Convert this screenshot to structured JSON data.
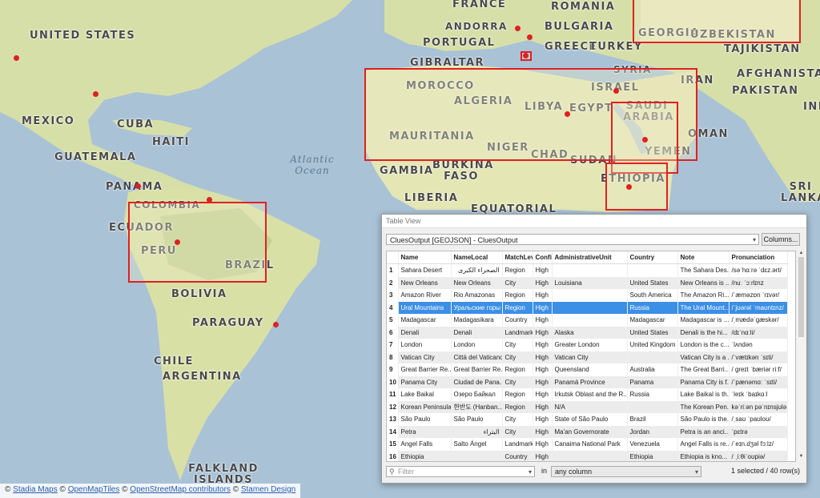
{
  "map": {
    "countries": [
      "UNITED STATES",
      "MEXICO",
      "CUBA",
      "HAITI",
      "GUATEMALA",
      "PANAMA",
      "COLOMBIA",
      "ECUADOR",
      "PERU",
      "BRAZIL",
      "BOLIVIA",
      "PARAGUAY",
      "CHILE",
      "ARGENTINA",
      "FALKLAND ISLANDS",
      "FRANCE",
      "ROMANIA",
      "ANDORRA",
      "BULGARIA",
      "PORTUGAL",
      "GEORGIA",
      "UZBEKISTAN",
      "TAJIKISTAN",
      "GREECE",
      "TURKEY",
      "GIBRALTAR",
      "SYRIA",
      "ISRAEL",
      "IRAN",
      "AFGHANISTAN",
      "PAKISTAN",
      "MOROCCO",
      "ALGERIA",
      "LIBYA",
      "EGYPT",
      "SAUDI ARABIA",
      "OMAN",
      "YEMEN",
      "MAURITANIA",
      "NIGER",
      "CHAD",
      "SUDAN",
      "GAMBIA",
      "BURKINA FASO",
      "ETHIOPIA",
      "LIBERIA",
      "EQUATORIAL",
      "SRI LANKA",
      "IND"
    ],
    "ocean_label": "Atlantic Ocean",
    "colors": {
      "ocean": "#a9c2d6",
      "land": "#dfe6b6",
      "highlight": "#e02020"
    }
  },
  "attribution": {
    "items": [
      "Stadia Maps",
      "OpenMapTiles",
      "OpenStreetMap contributors",
      "Stamen Design"
    ],
    "symbol": "©"
  },
  "table_view": {
    "window_title": "Table View",
    "layer_select": "CluesOutput [GEOJSON] - CluesOutput",
    "columns_button": "Columns...",
    "headers": [
      "Name",
      "NameLocal",
      "MatchLev",
      "Confi",
      "AdministrativeUnit",
      "Country",
      "Note",
      "Pronunciation"
    ],
    "rows": [
      [
        "1",
        "Sahara Desert",
        "الصحراء الكبرى",
        "Region",
        "High",
        "",
        "",
        "The Sahara Des...",
        "/səˈhɑːrə ˈdɛz.ərt/"
      ],
      [
        "2",
        "New Orleans",
        "New Orleans",
        "City",
        "High",
        "Louisiana",
        "United States",
        "New Orleans is ...",
        "/nuː ˈɔːrlɪnz"
      ],
      [
        "3",
        "Amazon River",
        "Rio Amazonas",
        "Region",
        "High",
        "",
        "South America",
        "The Amazon Ri...",
        "/ˈæməzɒn ˈrɪvər/"
      ],
      [
        "4",
        "Ural Mountains",
        "Уральские горы",
        "Region",
        "High",
        "",
        "Russia",
        "The Ural Mount...",
        "/ˈjʊərəl ˈmaʊntɪnz/"
      ],
      [
        "5",
        "Madagascar",
        "Madagasikara",
        "Country",
        "High",
        "",
        "Madagascar",
        "Madagascar is ...",
        "/ˌmædəˈɡæskər/"
      ],
      [
        "6",
        "Denali",
        "Denali",
        "Landmark",
        "High",
        "Alaska",
        "United States",
        "Denali is the hi...",
        "/dɪˈnɑːli/"
      ],
      [
        "7",
        "London",
        "London",
        "City",
        "High",
        "Greater London",
        "United Kingdom",
        "London is the c...",
        "ˈlʌndən"
      ],
      [
        "8",
        "Vatican City",
        "Città del Vaticano",
        "City",
        "High",
        "Vatican City",
        "",
        "Vatican City is a ...",
        "/ˈvætɪkən ˈsɪti/"
      ],
      [
        "9",
        "Great Barrier Re...",
        "Great Barrier Re...",
        "Region",
        "High",
        "Queensland",
        "Australia",
        "The Great Barri...",
        "/ ɡreɪt ˈbæriər riːf/"
      ],
      [
        "10",
        "Panama City",
        "Ciudad de Pana...",
        "City",
        "High",
        "Panamá Province",
        "Panama",
        "Panama City is f...",
        "/ˈpænəmɑː ˈsɪti/"
      ],
      [
        "11",
        "Lake Baikal",
        "Озеро Байкал",
        "Region",
        "High",
        "Irkutsk Oblast and the R...",
        "Russia",
        "Lake Baikal is th...",
        "ˈleɪk ˈbaɪkɑːl"
      ],
      [
        "12",
        "Korean Peninsula",
        "한반도 (Hanban...",
        "Region",
        "High",
        "N/A",
        "",
        "The Korean Pen...",
        "kəˈriːən pəˈnɪnsjʊlə"
      ],
      [
        "13",
        "São Paulo",
        "São Paulo",
        "City",
        "High",
        "State of São Paulo",
        "Brazil",
        "São Paulo is the...",
        "/ˌsaʊ ˈpaʊloʊ/"
      ],
      [
        "14",
        "Petra",
        "البتراء",
        "City",
        "High",
        "Ma'an Governorate",
        "Jordan",
        "Petra is an anci...",
        "ˈpɛtrə"
      ],
      [
        "15",
        "Angel Falls",
        "Salto Ángel",
        "Landmark",
        "High",
        "Canaima National Park",
        "Venezuela",
        "Angel Falls is re...",
        "/ˈeɪn.dʒəl fɔːlz/"
      ],
      [
        "16",
        "Ethiopia",
        "",
        "Country",
        "High",
        "",
        "Ethiopia",
        "Ethiopia is kno...",
        "/ ˌiːθiˈoʊpiə/"
      ]
    ],
    "selected_row": 4,
    "filter_placeholder": "Filter",
    "in_label": "in",
    "column_select": "any column",
    "status": "1 selected / 40 row(s)"
  }
}
